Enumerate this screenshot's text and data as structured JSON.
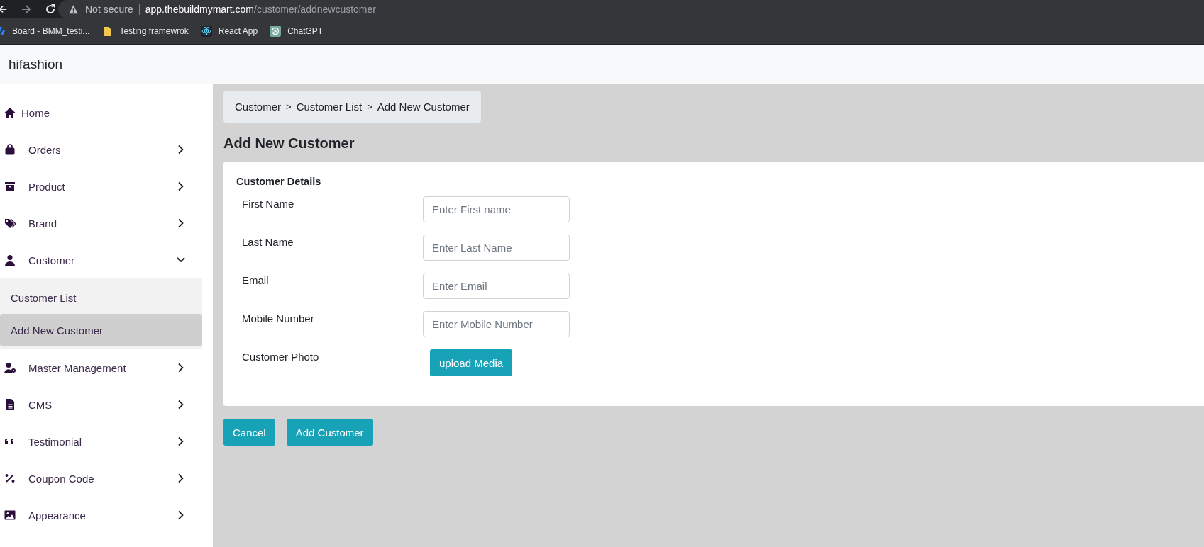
{
  "browser": {
    "security": "Not secure",
    "url_host": "app.thebuildmymart.com",
    "url_path": "/customer/addnewcustomer",
    "bookmarks": [
      {
        "label": "Board - BMM_testi...",
        "kind": "board"
      },
      {
        "label": "Testing framewrok",
        "kind": "folder"
      },
      {
        "label": "React App",
        "kind": "react"
      },
      {
        "label": "ChatGPT",
        "kind": "chat"
      }
    ]
  },
  "app": {
    "brand": "hifashion"
  },
  "sidebar": {
    "items": [
      {
        "label": "Home",
        "kind": "link"
      },
      {
        "label": "Orders",
        "kind": "group",
        "expanded": false
      },
      {
        "label": "Product",
        "kind": "group",
        "expanded": false
      },
      {
        "label": "Brand",
        "kind": "group",
        "expanded": false
      },
      {
        "label": "Customer",
        "kind": "group",
        "expanded": true,
        "children": [
          {
            "label": "Customer List",
            "selected": false
          },
          {
            "label": "Add New Customer",
            "selected": true
          }
        ]
      },
      {
        "label": "Master Management",
        "kind": "group",
        "expanded": false
      },
      {
        "label": "CMS",
        "kind": "group",
        "expanded": false
      },
      {
        "label": "Testimonial",
        "kind": "group",
        "expanded": false
      },
      {
        "label": "Coupon Code",
        "kind": "group",
        "expanded": false
      },
      {
        "label": "Appearance",
        "kind": "group",
        "expanded": false
      }
    ]
  },
  "breadcrumb": {
    "items": [
      "Customer",
      "Customer List",
      "Add New Customer"
    ],
    "separator": ">"
  },
  "page_title": "Add New Customer",
  "form": {
    "section_title": "Customer Details",
    "fields": [
      {
        "label": "First Name",
        "kind": "input",
        "placeholder": "Enter First name"
      },
      {
        "label": "Last Name",
        "kind": "input",
        "placeholder": "Enter Last Name"
      },
      {
        "label": "Email",
        "kind": "input",
        "placeholder": "Enter Email"
      },
      {
        "label": "Mobile Number",
        "kind": "input",
        "placeholder": "Enter Mobile Number"
      },
      {
        "label": "Customer Photo",
        "kind": "upload",
        "button": "upload Media"
      }
    ]
  },
  "buttons": [
    "Cancel",
    "Add Customer"
  ]
}
